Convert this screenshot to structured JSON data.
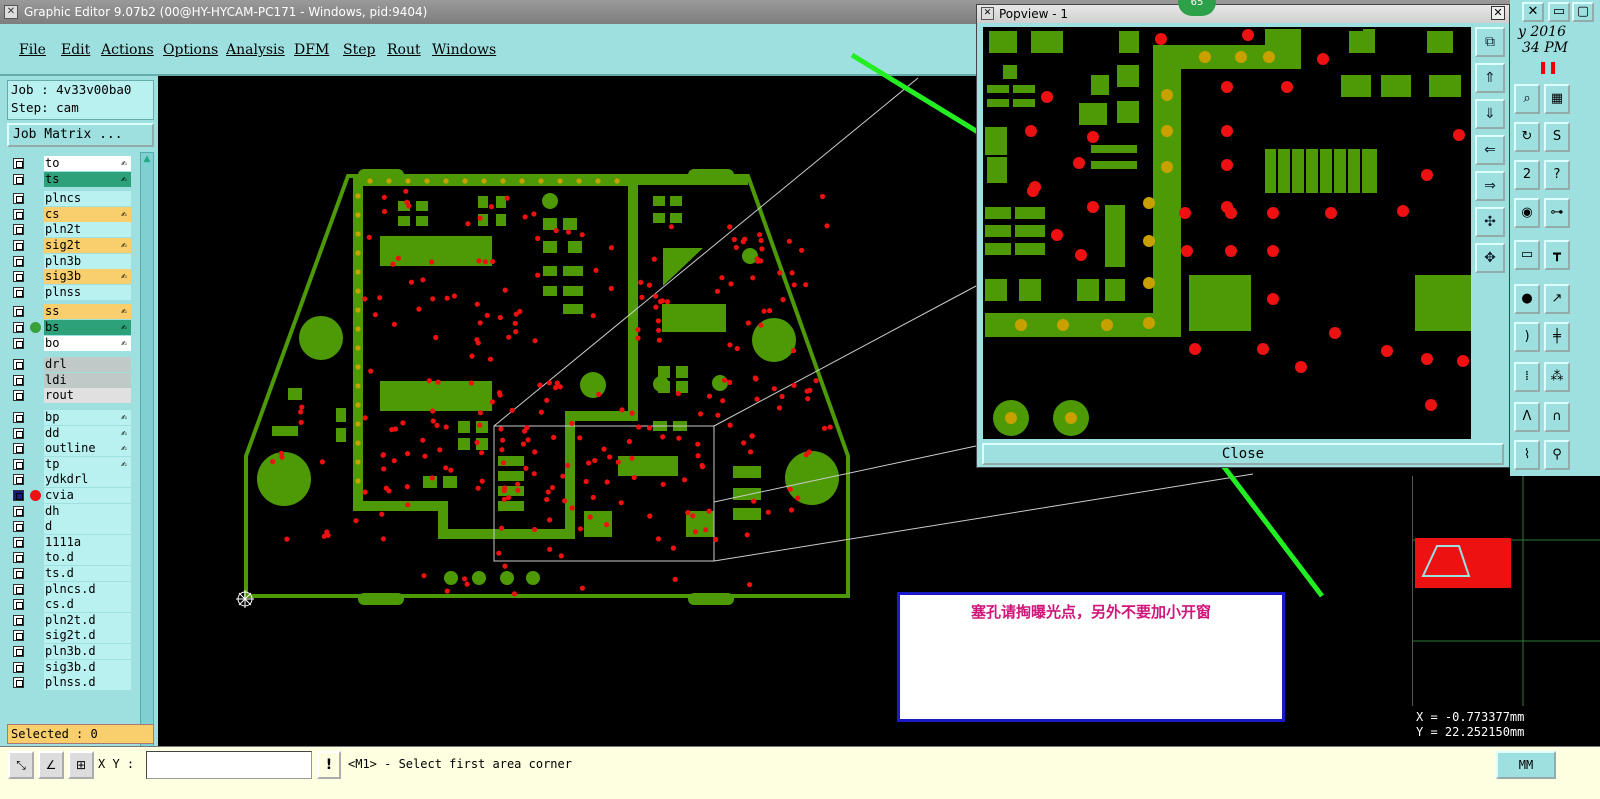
{
  "window": {
    "title": "Graphic Editor 9.07b2 (00@HY-HYCAM-PC171 - Windows, pid:9404)"
  },
  "menu": [
    "File",
    "Edit",
    "Actions",
    "Options",
    "Analysis",
    "DFM",
    "Step",
    "Rout",
    "Windows"
  ],
  "job": {
    "job_line": "Job : 4v33v00ba0",
    "step_line": "Step: cam",
    "matrix_button": "Job Matrix ..."
  },
  "layers": [
    {
      "name": "to",
      "color": "#ffffff",
      "editable": true
    },
    {
      "name": "ts",
      "color": "#2ca17a",
      "editable": true
    },
    {
      "name": "plncs",
      "color": "#b9f0f0",
      "editable": false
    },
    {
      "name": "cs",
      "color": "#f9cf6d",
      "editable": true
    },
    {
      "name": "pln2t",
      "color": "#b9f0f0",
      "editable": false
    },
    {
      "name": "sig2t",
      "color": "#f9cf6d",
      "editable": true
    },
    {
      "name": "pln3b",
      "color": "#b9f0f0",
      "editable": false
    },
    {
      "name": "sig3b",
      "color": "#f9cf6d",
      "editable": true
    },
    {
      "name": "plnss",
      "color": "#b9f0f0",
      "editable": false
    },
    {
      "name": "ss",
      "color": "#f9cf6d",
      "editable": true
    },
    {
      "name": "bs",
      "color": "#2ca17a",
      "editable": true,
      "dot": "#3aa13a"
    },
    {
      "name": "bo",
      "color": "#ffffff",
      "editable": true
    },
    {
      "name": "drl",
      "color": "#c0c8c8",
      "editable": false
    },
    {
      "name": "ldi",
      "color": "#c0c8c8",
      "editable": false
    },
    {
      "name": "rout",
      "color": "#e0e0e0",
      "editable": false
    },
    {
      "name": "bp",
      "color": "#b9f0f0",
      "editable": true
    },
    {
      "name": "dd",
      "color": "#b9f0f0",
      "editable": true
    },
    {
      "name": "outline",
      "color": "#b9f0f0",
      "editable": true
    },
    {
      "name": "tp",
      "color": "#b9f0f0",
      "editable": true
    },
    {
      "name": "ydkdrl",
      "color": "#b9f0f0",
      "editable": false
    },
    {
      "name": "cvia",
      "color": "#b9f0f0",
      "editable": false,
      "dot": "#ee1111",
      "active": true
    },
    {
      "name": "dh",
      "color": "#b9f0f0",
      "editable": false
    },
    {
      "name": "d",
      "color": "#b9f0f0",
      "editable": false
    },
    {
      "name": "1111a",
      "color": "#b9f0f0",
      "editable": false
    },
    {
      "name": "to.d",
      "color": "#b9f0f0",
      "editable": false
    },
    {
      "name": "ts.d",
      "color": "#b9f0f0",
      "editable": false
    },
    {
      "name": "plncs.d",
      "color": "#b9f0f0",
      "editable": false
    },
    {
      "name": "cs.d",
      "color": "#b9f0f0",
      "editable": false
    },
    {
      "name": "pln2t.d",
      "color": "#b9f0f0",
      "editable": false
    },
    {
      "name": "sig2t.d",
      "color": "#b9f0f0",
      "editable": false
    },
    {
      "name": "pln3b.d",
      "color": "#b9f0f0",
      "editable": false
    },
    {
      "name": "sig3b.d",
      "color": "#b9f0f0",
      "editable": false
    },
    {
      "name": "plnss.d",
      "color": "#b9f0f0",
      "editable": false
    }
  ],
  "selected": "Selected : 0",
  "popview": {
    "title": "Popview - 1",
    "close_label": "Close"
  },
  "badge": "65",
  "date_text": {
    "line1": "y 2016",
    "line2": "34 PM"
  },
  "note": "塞孔请掏曝光点，另外不要加小开窗",
  "coords": {
    "x": "X = -0.773377mm",
    "y": "Y = 22.252150mm"
  },
  "status": {
    "xy_label": "X Y :",
    "xy_value": "",
    "prompt": "<M1> - Select first area corner",
    "units": "MM"
  },
  "colors": {
    "copper": "#4e9a06",
    "via": "#ee1111",
    "plugged": "#c8a000",
    "panel": "#9ee0e0",
    "arrow": "#22ee22",
    "note_text": "#d0167a"
  }
}
